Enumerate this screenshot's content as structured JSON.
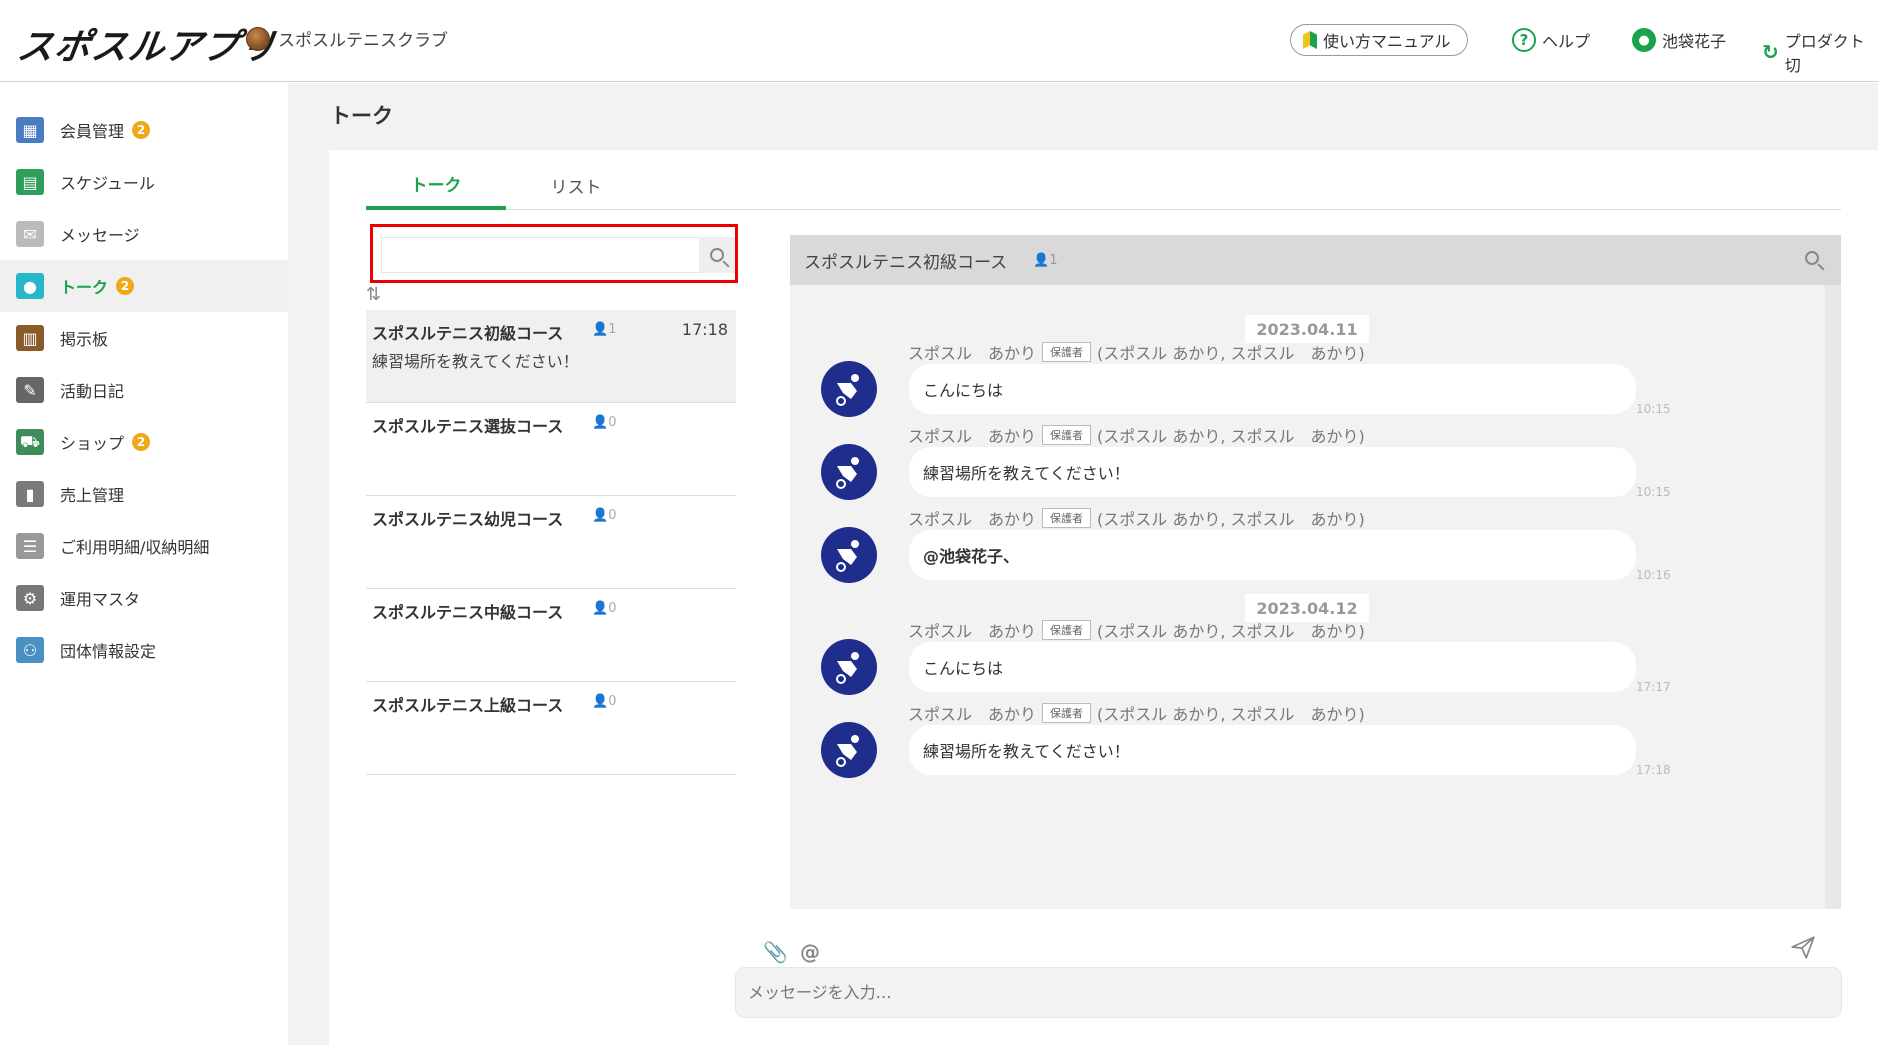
{
  "header": {
    "logo": "スポスルアプリ",
    "club_name": "スポスルテニスクラブ",
    "manual_label": "使い方マニュアル",
    "help_label": "ヘルプ",
    "user_name": "池袋花子",
    "product_label": "プロダクト切"
  },
  "sidebar": {
    "items": [
      {
        "label": "会員管理",
        "badge": "2",
        "icon": "members-icon",
        "color": "#4a7cc2"
      },
      {
        "label": "スケジュール",
        "badge": "",
        "icon": "calendar-icon",
        "color": "#2e9e5a"
      },
      {
        "label": "メッセージ",
        "badge": "",
        "icon": "mail-icon",
        "color": "#bbbbbb"
      },
      {
        "label": "トーク",
        "badge": "2",
        "icon": "talk-icon",
        "color": "#27b7c8"
      },
      {
        "label": "掲示板",
        "badge": "",
        "icon": "board-icon",
        "color": "#8a5a2b"
      },
      {
        "label": "活動日記",
        "badge": "",
        "icon": "diary-icon",
        "color": "#666666"
      },
      {
        "label": "ショップ",
        "badge": "2",
        "icon": "cart-icon",
        "color": "#3d8c5a"
      },
      {
        "label": "売上管理",
        "badge": "",
        "icon": "sales-icon",
        "color": "#7a7a7a"
      },
      {
        "label": "ご利用明細/収納明細",
        "badge": "",
        "icon": "receipt-icon",
        "color": "#999999"
      },
      {
        "label": "運用マスタ",
        "badge": "",
        "icon": "gear-icon",
        "color": "#777777"
      },
      {
        "label": "団体情報設定",
        "badge": "",
        "icon": "group-icon",
        "color": "#4a90c2"
      }
    ]
  },
  "page": {
    "title": "トーク",
    "tabs": [
      "トーク",
      "リスト"
    ]
  },
  "search": {
    "value": "",
    "placeholder": ""
  },
  "rooms": [
    {
      "name": "スポスルテニス初級コース",
      "count": "1",
      "time": "17:18",
      "last": "練習場所を教えてください！"
    },
    {
      "name": "スポスルテニス選抜コース",
      "count": "0",
      "time": "",
      "last": ""
    },
    {
      "name": "スポスルテニス幼児コース",
      "count": "0",
      "time": "",
      "last": ""
    },
    {
      "name": "スポスルテニス中級コース",
      "count": "0",
      "time": "",
      "last": ""
    },
    {
      "name": "スポスルテニス上級コース",
      "count": "0",
      "time": "",
      "last": ""
    }
  ],
  "chat": {
    "title": "スポスルテニス初級コース",
    "count": "1",
    "dates": [
      "2023.04.11",
      "2023.04.12"
    ],
    "sender_name": "スポスル　あかり",
    "sender_tag": "保護者",
    "sender_extra": "(スポスル あかり, スポスル　あかり)",
    "messages": [
      {
        "text": "こんにちは",
        "time": "10:15"
      },
      {
        "text": "練習場所を教えてください！",
        "time": "10:15"
      },
      {
        "text": "@池袋花子、",
        "time": "10:16"
      },
      {
        "text": "こんにちは",
        "time": "17:17"
      },
      {
        "text": "練習場所を教えてください！",
        "time": "17:18"
      }
    ]
  },
  "composer": {
    "placeholder": "メッセージを入力…",
    "at_symbol": "@"
  }
}
